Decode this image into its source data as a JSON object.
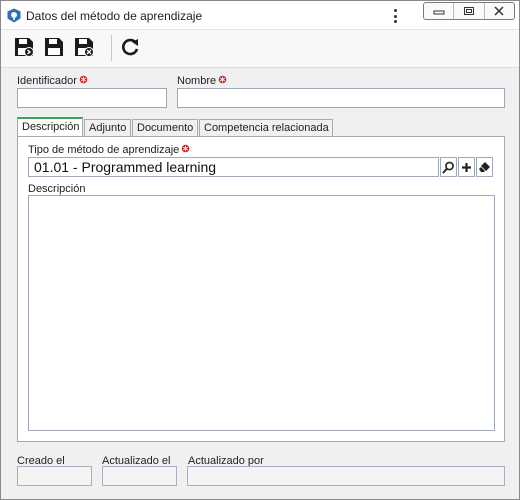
{
  "window": {
    "title": "Datos del método de aprendizaje",
    "icons": [
      "app-icon",
      "kebab-menu-icon",
      "minimize-icon",
      "maximize-icon",
      "close-icon"
    ]
  },
  "toolbar": {
    "buttons": [
      {
        "name": "save-and-new",
        "icon": "floppy-disk-plus-icon"
      },
      {
        "name": "save",
        "icon": "floppy-disk-icon"
      },
      {
        "name": "save-and-close",
        "icon": "floppy-disk-close-icon"
      },
      {
        "name": "refresh",
        "icon": "refresh-icon"
      }
    ]
  },
  "header_fields": {
    "id_label": "Identificador",
    "id_value": "",
    "name_label": "Nombre",
    "name_value": ""
  },
  "tabs": [
    {
      "label": "Descripción",
      "active": true
    },
    {
      "label": "Adjunto",
      "active": false
    },
    {
      "label": "Documento",
      "active": false
    },
    {
      "label": "Competencia relacionada",
      "active": false
    }
  ],
  "description_tab": {
    "type_label": "Tipo de método de aprendizaje",
    "type_value": "01.01 - Programmed learning",
    "desc_label": "Descripción",
    "desc_value": ""
  },
  "footer": {
    "created_label": "Creado el",
    "created_value": "",
    "updated_label": "Actualizado el",
    "updated_value": "",
    "updated_by_label": "Actualizado por",
    "updated_by_value": ""
  },
  "colors": {
    "required": "#d42020",
    "active_tab": "#3ea34a",
    "app_icon": "#2f6db5"
  }
}
